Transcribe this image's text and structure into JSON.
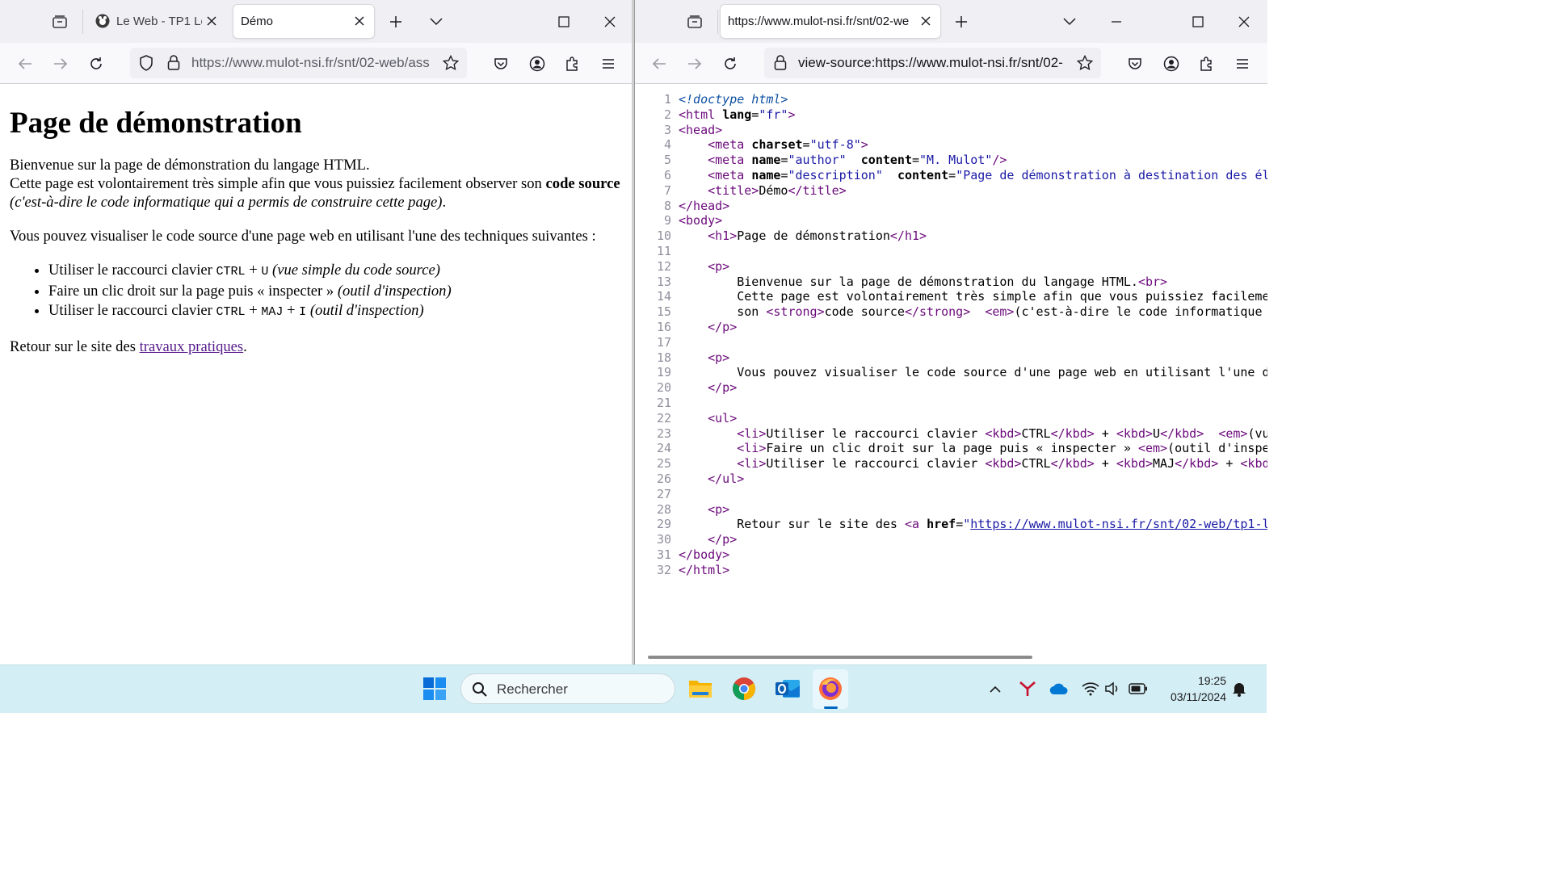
{
  "left_window": {
    "tabs": [
      {
        "title": "Le Web - TP1 Le",
        "active": false
      },
      {
        "title": "Démo",
        "active": true
      }
    ],
    "url": "https://www.mulot-nsi.fr/snt/02-web/ass",
    "page": {
      "heading": "Page de démonstration",
      "p1_line1": "Bienvenue sur la page de démonstration du langage HTML.",
      "p1_line2": "Cette page est volontairement très simple afin que vous puissiez facilement observer son ",
      "p1_strong": "code source",
      "p1_em": "(c'est-à-dire le code informatique qui a permis de construire cette page)",
      "p1_end": ".",
      "p2": "Vous pouvez visualiser le code source d'une page web en utilisant l'une des techniques suivantes :",
      "list": [
        {
          "before": "Utiliser le raccourci clavier ",
          "k1": "CTRL",
          "sep1": " + ",
          "k2": "U",
          "sep2": "",
          "k3": "",
          "after": " ",
          "em": "(vue simple du code source)"
        },
        {
          "before": "Faire un clic droit sur la page puis « inspecter » ",
          "k1": "",
          "sep1": "",
          "k2": "",
          "sep2": "",
          "k3": "",
          "after": "",
          "em": "(outil d'inspection)"
        },
        {
          "before": "Utiliser le raccourci clavier ",
          "k1": "CTRL",
          "sep1": " + ",
          "k2": "MAJ",
          "sep2": " + ",
          "k3": "I",
          "after": " ",
          "em": "(outil d'inspection)"
        }
      ],
      "p3_before": "Retour sur le site des ",
      "p3_link": "travaux pratiques",
      "p3_after": "."
    }
  },
  "right_window": {
    "tab_title": "https://www.mulot-nsi.fr/snt/02-we",
    "url": "view-source:https://www.mulot-nsi.fr/snt/02-",
    "source_lines": [
      [
        [
          "cm",
          "<!doctype html>"
        ]
      ],
      [
        [
          "tg",
          "<html "
        ],
        [
          "at",
          "lang"
        ],
        [
          "",
          "="
        ],
        [
          "av",
          "\"fr\""
        ],
        [
          "tg",
          ">"
        ]
      ],
      [
        [
          "tg",
          "<head>"
        ]
      ],
      [
        [
          "",
          "    "
        ],
        [
          "tg",
          "<meta "
        ],
        [
          "at",
          "charset"
        ],
        [
          "",
          "="
        ],
        [
          "av",
          "\"utf-8\""
        ],
        [
          "tg",
          ">"
        ]
      ],
      [
        [
          "",
          "    "
        ],
        [
          "tg",
          "<meta "
        ],
        [
          "at",
          "name"
        ],
        [
          "",
          "="
        ],
        [
          "av",
          "\"author\""
        ],
        [
          "",
          "  "
        ],
        [
          "at",
          "content"
        ],
        [
          "",
          "="
        ],
        [
          "av",
          "\"M. Mulot\""
        ],
        [
          "tg",
          "/>"
        ]
      ],
      [
        [
          "",
          "    "
        ],
        [
          "tg",
          "<meta "
        ],
        [
          "at",
          "name"
        ],
        [
          "",
          "="
        ],
        [
          "av",
          "\"description\""
        ],
        [
          "",
          "  "
        ],
        [
          "at",
          "content"
        ],
        [
          "",
          "="
        ],
        [
          "av",
          "\"Page de démonstration à destination des élèves"
        ]
      ],
      [
        [
          "",
          "    "
        ],
        [
          "tg",
          "<title>"
        ],
        [
          "",
          "Démo"
        ],
        [
          "tg",
          "</title>"
        ]
      ],
      [
        [
          "tg",
          "</head>"
        ]
      ],
      [
        [
          "tg",
          "<body>"
        ]
      ],
      [
        [
          "",
          "    "
        ],
        [
          "tg",
          "<h1>"
        ],
        [
          "",
          "Page de démonstration"
        ],
        [
          "tg",
          "</h1>"
        ]
      ],
      [],
      [
        [
          "",
          "    "
        ],
        [
          "tg",
          "<p>"
        ]
      ],
      [
        [
          "",
          "        Bienvenue sur la page de démonstration du langage HTML."
        ],
        [
          "tg",
          "<br>"
        ]
      ],
      [
        [
          "",
          "        Cette page est volontairement très simple afin que vous puissiez facilement observer"
        ]
      ],
      [
        [
          "",
          "        son "
        ],
        [
          "tg",
          "<strong>"
        ],
        [
          "",
          "code source"
        ],
        [
          "tg",
          "</strong>"
        ],
        [
          "",
          "  "
        ],
        [
          "tg",
          "<em>"
        ],
        [
          "",
          "(c'est-à-dire le code informatique qui a permis"
        ]
      ],
      [
        [
          "",
          "    "
        ],
        [
          "tg",
          "</p>"
        ]
      ],
      [],
      [
        [
          "",
          "    "
        ],
        [
          "tg",
          "<p>"
        ]
      ],
      [
        [
          "",
          "        Vous pouvez visualiser le code source d'une page web en utilisant l'une des techniques"
        ]
      ],
      [
        [
          "",
          "    "
        ],
        [
          "tg",
          "</p>"
        ]
      ],
      [],
      [
        [
          "",
          "    "
        ],
        [
          "tg",
          "<ul>"
        ]
      ],
      [
        [
          "",
          "        "
        ],
        [
          "tg",
          "<li>"
        ],
        [
          "",
          "Utiliser le raccourci clavier "
        ],
        [
          "tg",
          "<kbd>"
        ],
        [
          "",
          "CTRL"
        ],
        [
          "tg",
          "</kbd>"
        ],
        [
          "",
          " + "
        ],
        [
          "tg",
          "<kbd>"
        ],
        [
          "",
          "U"
        ],
        [
          "tg",
          "</kbd>"
        ],
        [
          "",
          "  "
        ],
        [
          "tg",
          "<em>"
        ],
        [
          "",
          "(vue simple"
        ]
      ],
      [
        [
          "",
          "        "
        ],
        [
          "tg",
          "<li>"
        ],
        [
          "",
          "Faire un clic droit sur la page puis « inspecter » "
        ],
        [
          "tg",
          "<em>"
        ],
        [
          "",
          "(outil d'inspection)"
        ]
      ],
      [
        [
          "",
          "        "
        ],
        [
          "tg",
          "<li>"
        ],
        [
          "",
          "Utiliser le raccourci clavier "
        ],
        [
          "tg",
          "<kbd>"
        ],
        [
          "",
          "CTRL"
        ],
        [
          "tg",
          "</kbd>"
        ],
        [
          "",
          " + "
        ],
        [
          "tg",
          "<kbd>"
        ],
        [
          "",
          "MAJ"
        ],
        [
          "tg",
          "</kbd>"
        ],
        [
          "",
          " + "
        ],
        [
          "tg",
          "<kbd>"
        ],
        [
          "",
          "I"
        ]
      ],
      [
        [
          "",
          "    "
        ],
        [
          "tg",
          "</ul>"
        ]
      ],
      [],
      [
        [
          "",
          "    "
        ],
        [
          "tg",
          "<p>"
        ]
      ],
      [
        [
          "",
          "        Retour sur le site des "
        ],
        [
          "tg",
          "<a "
        ],
        [
          "at",
          "href"
        ],
        [
          "",
          "="
        ],
        [
          "av",
          "\""
        ],
        [
          "lk",
          "https://www.mulot-nsi.fr/snt/02-web/tp1-langage"
        ]
      ],
      [
        [
          "",
          "    "
        ],
        [
          "tg",
          "</p>"
        ]
      ],
      [
        [
          "tg",
          "</body>"
        ]
      ],
      [
        [
          "tg",
          "</html>"
        ]
      ]
    ]
  },
  "taskbar": {
    "search_placeholder": "Rechercher",
    "time": "19:25",
    "date": "03/11/2024"
  }
}
